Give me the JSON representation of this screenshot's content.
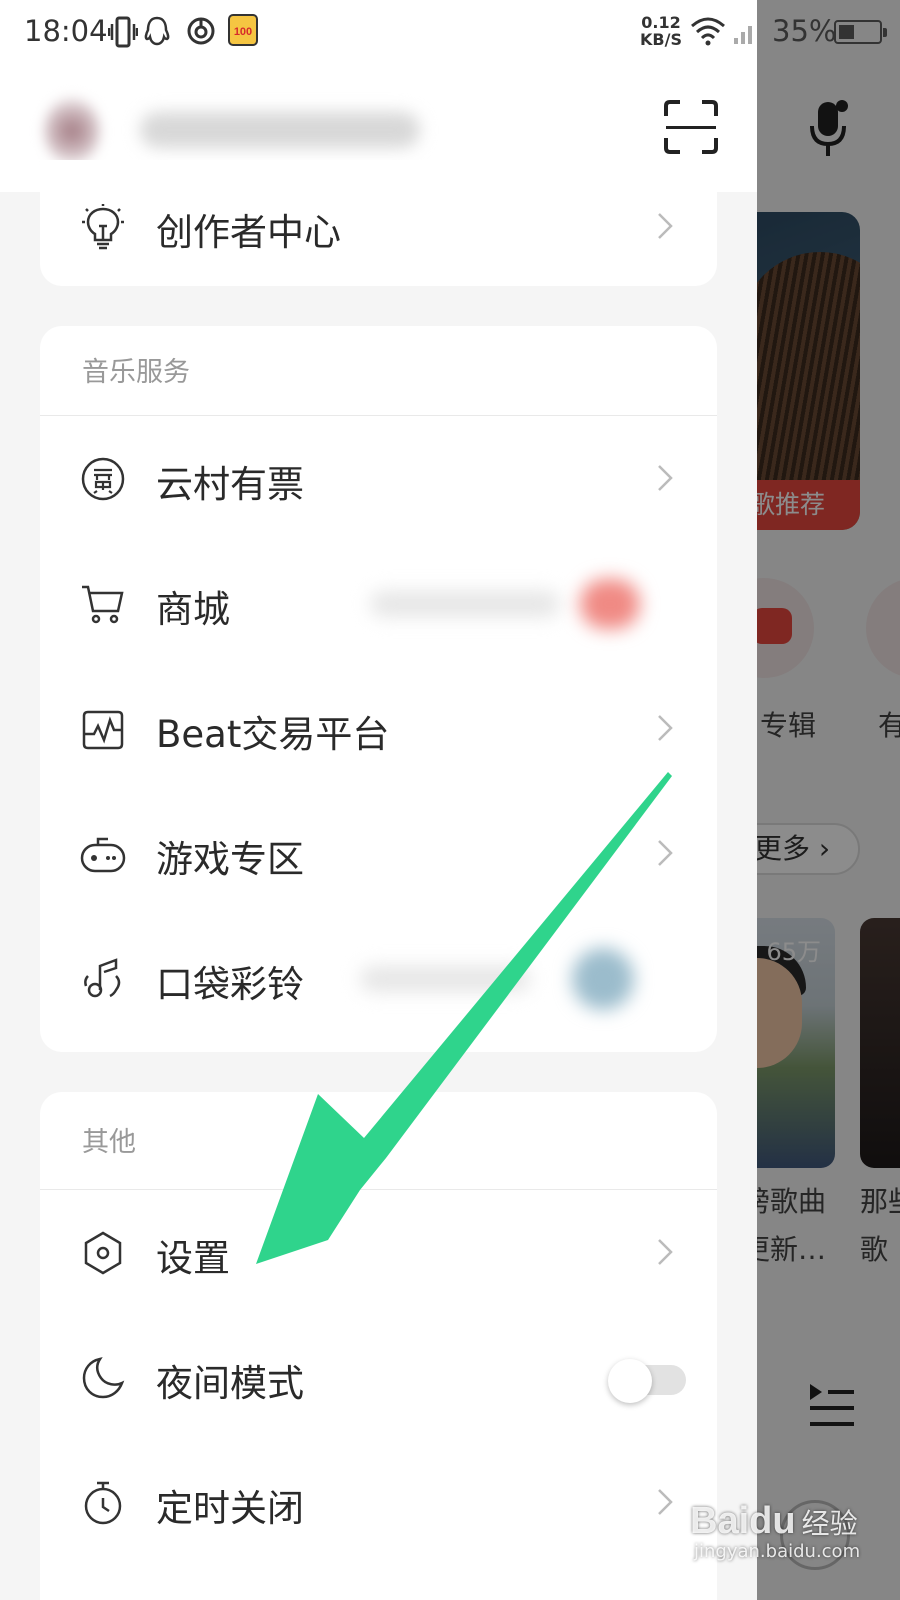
{
  "status_bar": {
    "time": "18:04",
    "net_speed_value": "0.12",
    "net_speed_unit": "KB/S",
    "battery": "35%",
    "notification_badge": "100"
  },
  "drawer": {
    "top_item": {
      "label": "创作者中心",
      "icon": "lightbulb-icon"
    },
    "music_services": {
      "title": "音乐服务",
      "items": [
        {
          "label": "云村有票",
          "icon": "ticket-icon"
        },
        {
          "label": "商城",
          "icon": "cart-icon"
        },
        {
          "label": "Beat交易平台",
          "icon": "beat-icon"
        },
        {
          "label": "游戏专区",
          "icon": "gamepad-icon"
        },
        {
          "label": "口袋彩铃",
          "icon": "ringtone-icon"
        }
      ]
    },
    "other": {
      "title": "其他",
      "items": [
        {
          "label": "设置",
          "icon": "settings-hexagon-icon"
        },
        {
          "label": "夜间模式",
          "icon": "moon-icon",
          "toggle": false
        },
        {
          "label": "定时关闭",
          "icon": "timer-icon"
        }
      ]
    }
  },
  "background_app": {
    "banner_tag": "歌推荐",
    "entry_label": "专辑",
    "entry_label_2": "有",
    "more_button": "更多",
    "playlist_count": "65万",
    "playlist_title_line1": "傍歌曲",
    "playlist_title_line2": "更新…",
    "playlist2_line1": "那些",
    "playlist2_line2": "歌"
  },
  "watermark": {
    "brand": "Baidu",
    "suffix": "经验",
    "url": "jingyan.baidu.com"
  },
  "colors": {
    "accent_red": "#e8473f",
    "annotation_arrow": "#2fd48c",
    "section_title": "#999999"
  }
}
